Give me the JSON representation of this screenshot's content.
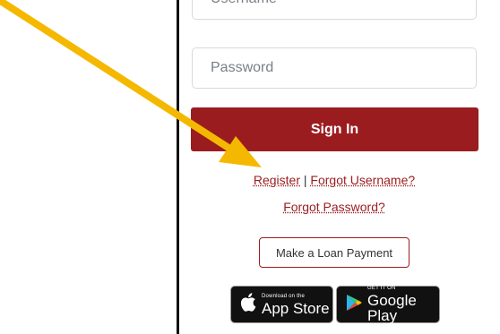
{
  "login": {
    "username_placeholder": "Username",
    "password_placeholder": "Password",
    "signin_label": "Sign In",
    "register_label": "Register",
    "separator": "|",
    "forgot_username_label": "Forgot Username?",
    "forgot_password_label": "Forgot Password?",
    "loan_payment_label": "Make a Loan Payment"
  },
  "stores": {
    "apple_small": "Download on the",
    "apple_big": "App Store",
    "google_small": "GET IT ON",
    "google_big": "Google Play"
  },
  "colors": {
    "brand_red": "#9b1c1f",
    "annotation_arrow": "#f5b800"
  },
  "icons": {
    "apple": "apple-icon",
    "google_play": "google-play-icon",
    "annotation": "arrow-annotation-icon"
  }
}
